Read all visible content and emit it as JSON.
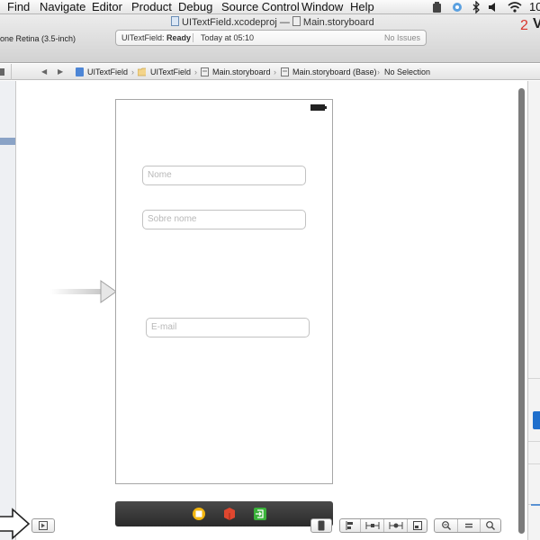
{
  "menubar": {
    "items": [
      "Find",
      "Navigate",
      "Editor",
      "Product",
      "Debug",
      "Source Control",
      "Window",
      "Help"
    ],
    "status_icons": [
      "battery-status-icon",
      "sync-icon",
      "bluetooth-icon",
      "volume-icon",
      "wifi-icon"
    ],
    "clock": "10"
  },
  "toolbar": {
    "project_file": "UITextField.xcodeproj",
    "title_separator": "—",
    "storyboard_file": "Main.storyboard",
    "scheme_device": "one Retina (3.5-inch)",
    "activity": {
      "project": "UITextField:",
      "status": "Ready",
      "time": "Today at 05:10",
      "issues": "No Issues"
    },
    "badge_number": "2",
    "badge_letter": "V"
  },
  "jumpbar": {
    "back_glyph": "◀",
    "forward_glyph": "▶",
    "crumbs": [
      "UITextField",
      "UITextField",
      "Main.storyboard",
      "Main.storyboard (Base)",
      "No Selection"
    ]
  },
  "scene": {
    "fields": [
      {
        "placeholder": "Nome"
      },
      {
        "placeholder": "Sobre nome"
      },
      {
        "placeholder": "E-mail"
      }
    ]
  },
  "colors": {
    "accent_blue": "#1f6fcc",
    "badge_red": "#d9332b",
    "dock_dark": "#2a2a2a"
  }
}
